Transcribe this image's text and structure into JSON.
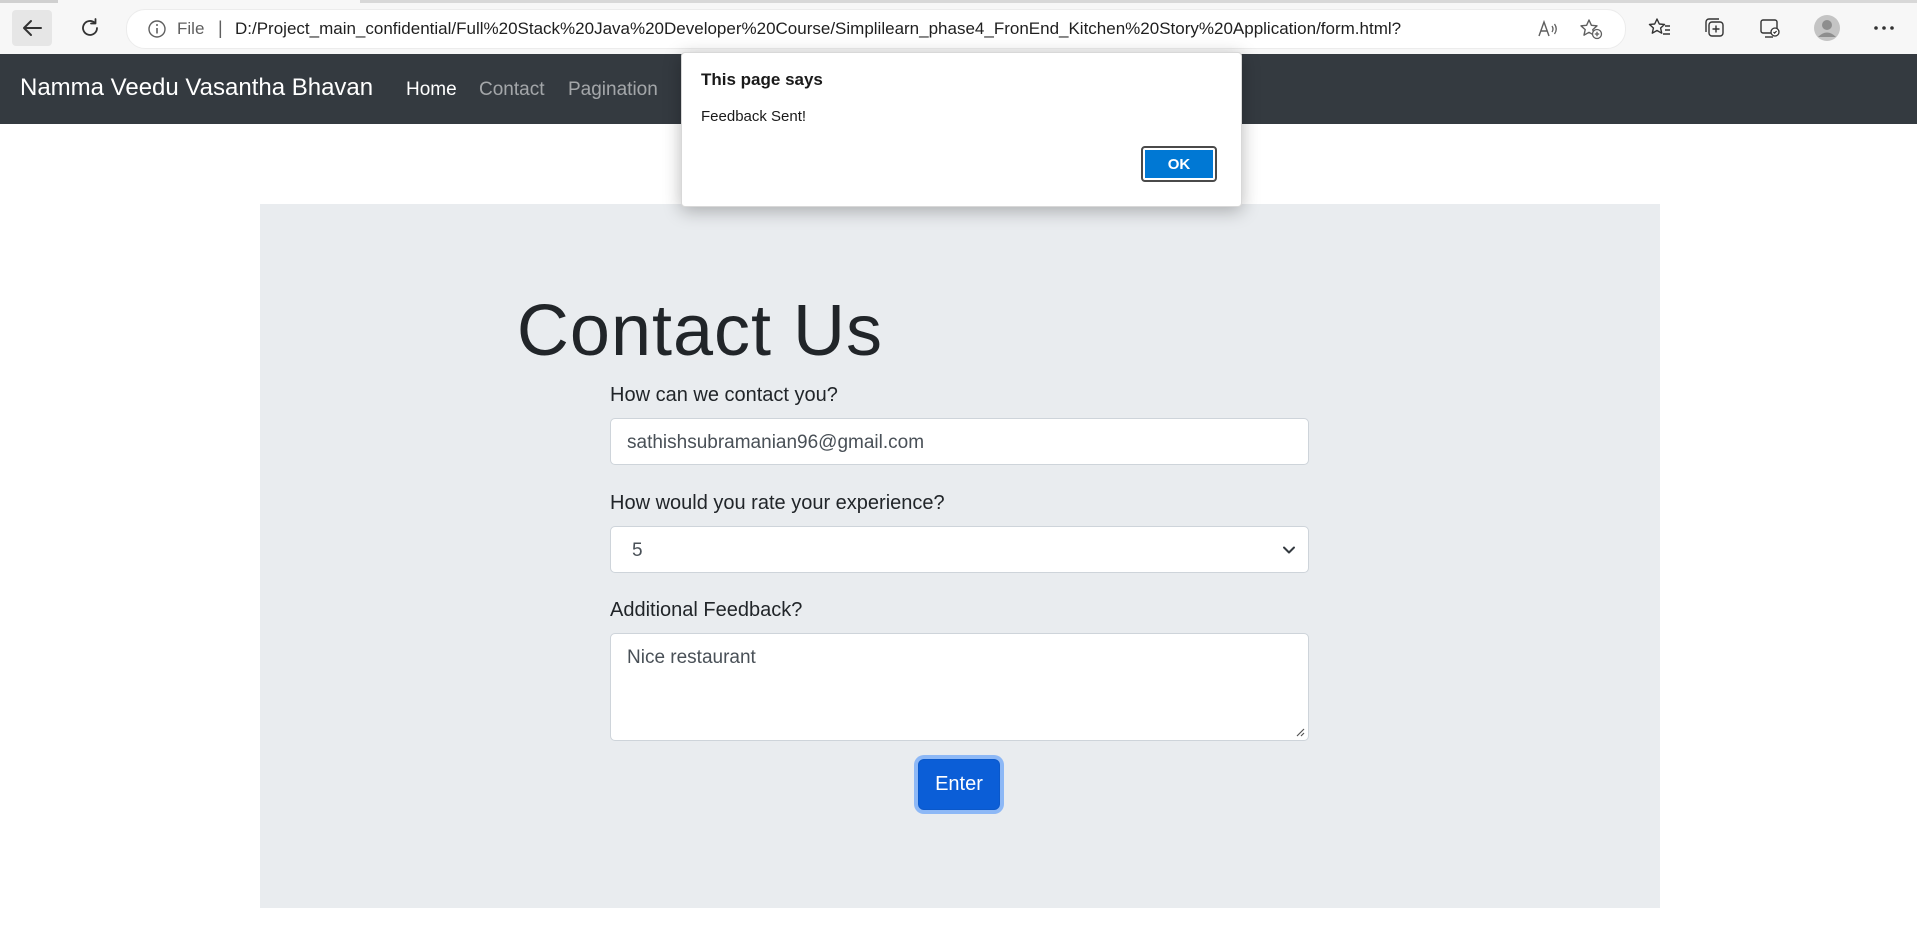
{
  "browser": {
    "file_label": "File",
    "separator": "|",
    "url": "D:/Project_main_confidential/Full%20Stack%20Java%20Developer%20Course/Simplilearn_phase4_FronEnd_Kitchen%20Story%20Application/form.html?",
    "icons": [
      "back-arrow-icon",
      "reload-icon",
      "info-icon",
      "read-aloud-icon",
      "add-favorite-icon",
      "favorites-icon",
      "collections-icon",
      "browser-essentials-icon",
      "profile-icon",
      "more-icon"
    ]
  },
  "navbar": {
    "brand": "Namma Veedu Vasantha Bhavan",
    "links": [
      {
        "label": "Home",
        "active": true
      },
      {
        "label": "Contact",
        "active": false
      },
      {
        "label": "Pagination",
        "active": false
      }
    ]
  },
  "main": {
    "title": "Contact Us",
    "contact_label": "How can we contact you?",
    "contact_value": "sathishsubramanian96@gmail.com",
    "rating_label": "How would you rate your experience?",
    "rating_value": "5",
    "feedback_label": "Additional Feedback?",
    "feedback_value": "Nice restaurant",
    "submit_label": "Enter"
  },
  "dialog": {
    "title": "This page says",
    "message": "Feedback Sent!",
    "ok_label": "OK"
  },
  "colors": {
    "navbar_bg": "#343a40",
    "jumbotron_bg": "#e9ecef",
    "primary_button": "#0b5ed7",
    "dialog_ok": "#0078d4"
  }
}
